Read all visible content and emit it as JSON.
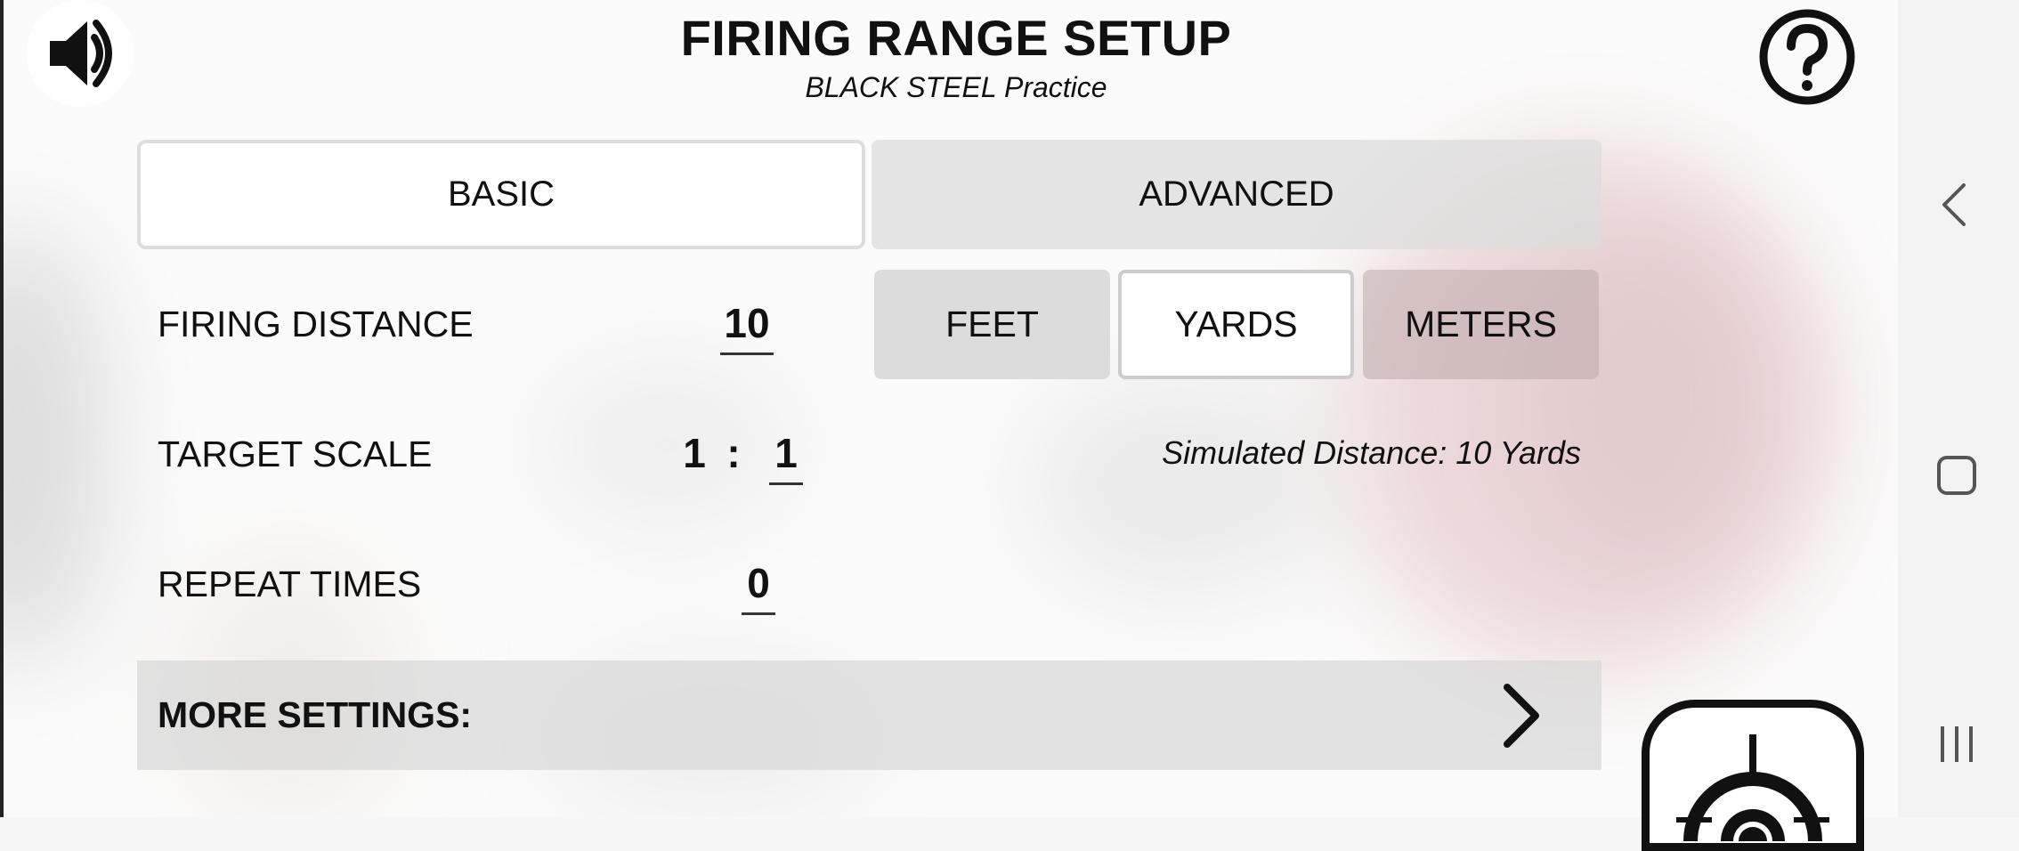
{
  "header": {
    "title": "FIRING RANGE SETUP",
    "subtitle": "BLACK STEEL Practice"
  },
  "icons": {
    "sound": "speaker-volume-icon",
    "help": "question-circle-icon",
    "fire": "target-crosshair-icon"
  },
  "tabs": [
    {
      "label": "BASIC",
      "selected": true
    },
    {
      "label": "ADVANCED",
      "selected": false
    }
  ],
  "settings": {
    "firing_distance": {
      "label": "FIRING DISTANCE",
      "value": "10"
    },
    "units": [
      {
        "label": "FEET",
        "selected": false
      },
      {
        "label": "YARDS",
        "selected": true
      },
      {
        "label": "METERS",
        "selected": false
      }
    ],
    "target_scale": {
      "label": "TARGET SCALE",
      "left": "1",
      "separator": ":",
      "right": "1"
    },
    "simulated_distance": "Simulated Distance: 10 Yards",
    "repeat_times": {
      "label": "REPEAT TIMES",
      "value": "0"
    },
    "more_settings": "MORE SETTINGS:"
  },
  "system_nav": [
    "back",
    "home",
    "recents"
  ]
}
